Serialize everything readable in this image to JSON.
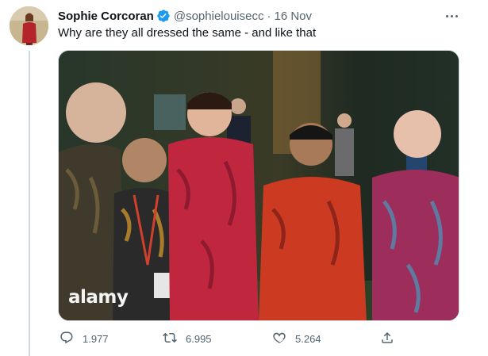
{
  "tweet": {
    "author_name": "Sophie Corcoran",
    "handle": "@sophielouisecc",
    "separator": "·",
    "date": "16 Nov",
    "text": "Why are they all dressed the same - and like that",
    "media_watermark": "alamy",
    "verified": true,
    "verified_icon": "verified-badge-icon",
    "accent_color": "#1d9bf0"
  },
  "actions": {
    "replies": "1.977",
    "retweets": "6.995",
    "likes": "5.264",
    "reply_icon": "reply-icon",
    "retweet_icon": "retweet-icon",
    "like_icon": "heart-icon",
    "share_icon": "share-icon"
  }
}
